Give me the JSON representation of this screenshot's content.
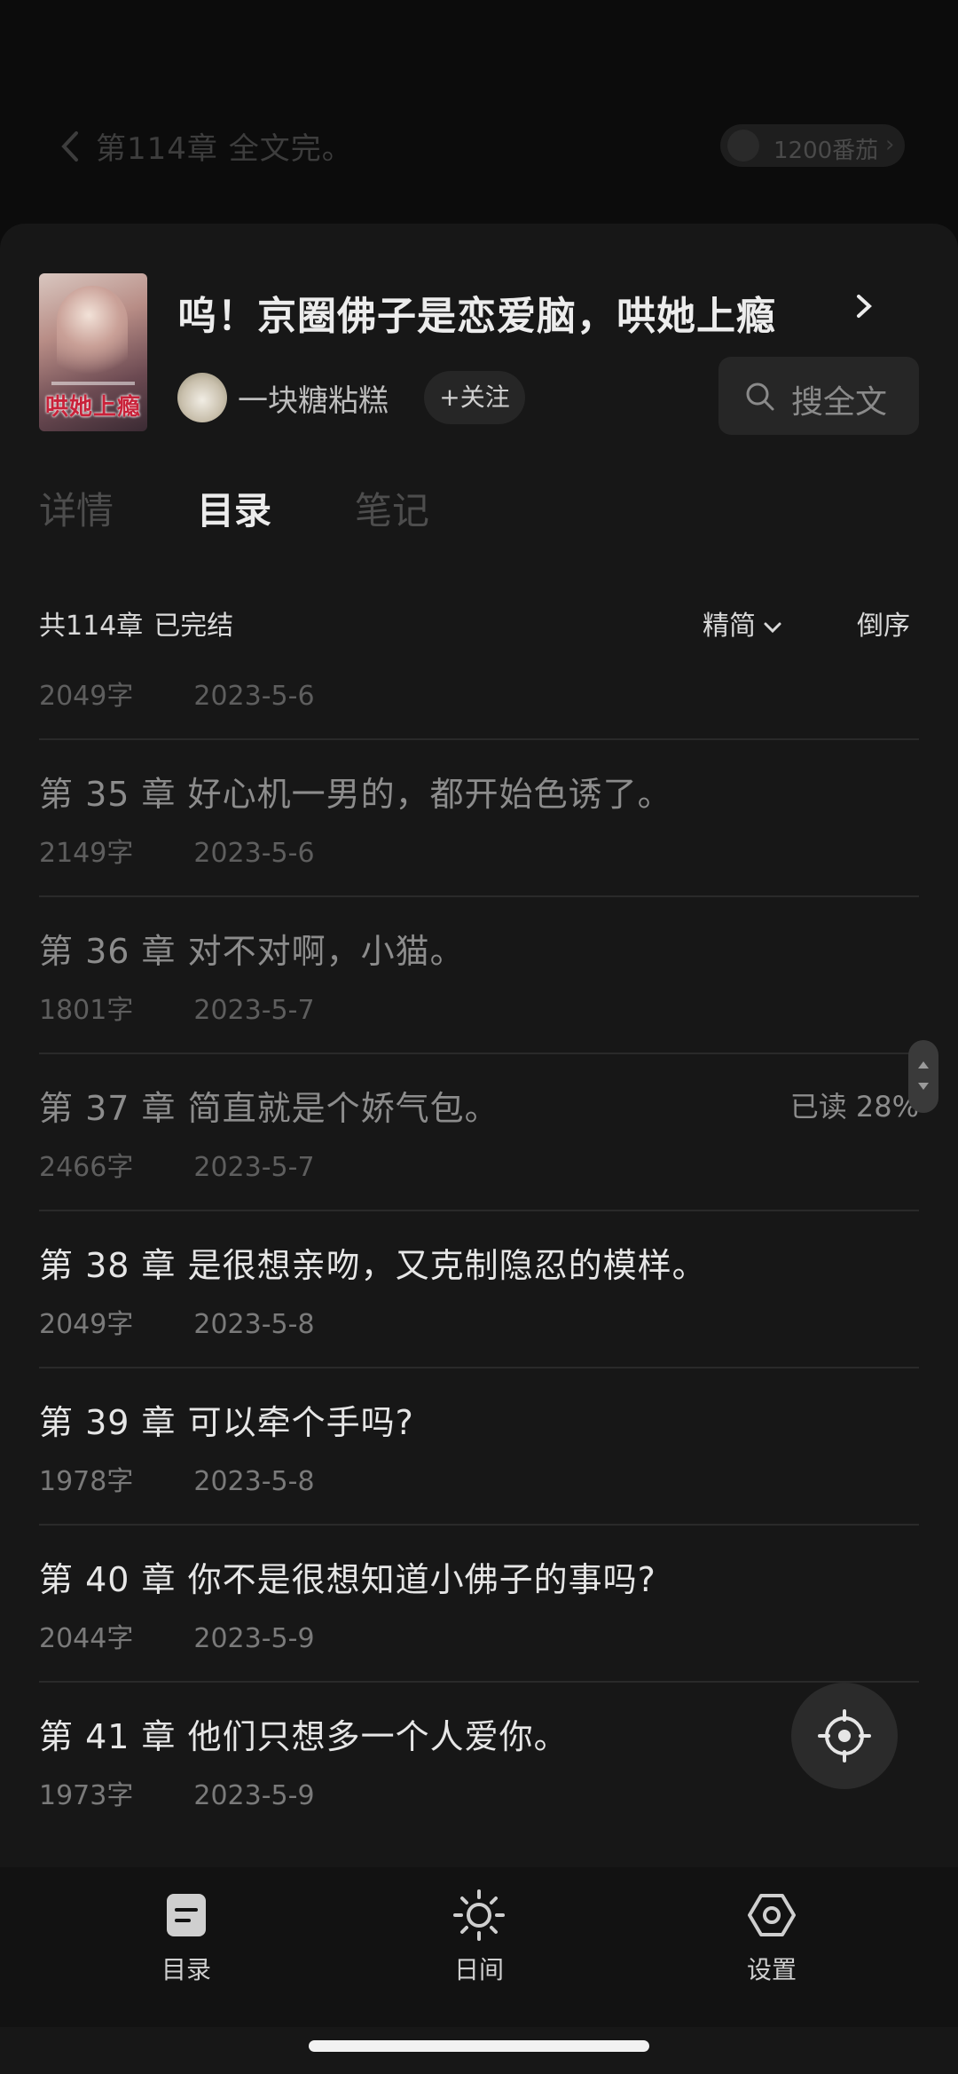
{
  "background": {
    "chapter_title": "第114章 全文完。",
    "coin_label": "1200番茄"
  },
  "book": {
    "title": "呜！京圈佛子是恋爱脑，哄她上瘾",
    "cover_text": "哄她上瘾",
    "author": "一块糖粘糕",
    "follow_label": "+关注",
    "search_label": "搜全文"
  },
  "tabs": [
    {
      "label": "详情",
      "active": false
    },
    {
      "label": "目录",
      "active": true
    },
    {
      "label": "笔记",
      "active": false
    }
  ],
  "summary": {
    "count": "共114章",
    "status": "已完结",
    "format": "精简",
    "order": "倒序"
  },
  "chapters": [
    {
      "title": "",
      "words": "2049字",
      "date": "2023-5-6",
      "read": true,
      "progress": ""
    },
    {
      "title": "第 35 章  好心机一男的，都开始色诱了。",
      "words": "2149字",
      "date": "2023-5-6",
      "read": true,
      "progress": ""
    },
    {
      "title": "第 36 章  对不对啊，小猫。",
      "words": "1801字",
      "date": "2023-5-7",
      "read": true,
      "progress": ""
    },
    {
      "title": "第 37 章  简直就是个娇气包。",
      "words": "2466字",
      "date": "2023-5-7",
      "read": true,
      "progress": "已读 28%"
    },
    {
      "title": "第 38 章  是很想亲吻，又克制隐忍的模样。",
      "words": "2049字",
      "date": "2023-5-8",
      "read": false,
      "progress": ""
    },
    {
      "title": "第 39 章  可以牵个手吗?",
      "words": "1978字",
      "date": "2023-5-8",
      "read": false,
      "progress": ""
    },
    {
      "title": "第 40 章  你不是很想知道小佛子的事吗?",
      "words": "2044字",
      "date": "2023-5-9",
      "read": false,
      "progress": ""
    },
    {
      "title": "第 41 章  他们只想多一个人爱你。",
      "words": "1973字",
      "date": "2023-5-9",
      "read": false,
      "progress": ""
    }
  ],
  "bottom_nav": [
    {
      "label": "目录",
      "icon": "catalog-icon"
    },
    {
      "label": "日间",
      "icon": "sun-icon"
    },
    {
      "label": "设置",
      "icon": "settings-icon"
    }
  ]
}
